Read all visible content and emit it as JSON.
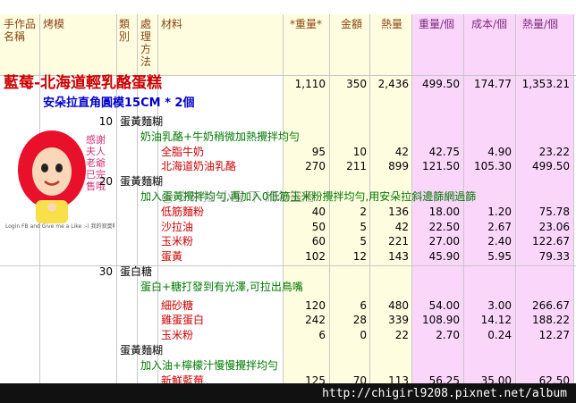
{
  "headers": {
    "name": "手作品名稱",
    "mold": "烤模",
    "category": "類別",
    "method": "處理方法",
    "material": "材料",
    "weight": "*重量*",
    "amount": "金額",
    "heat": "熱量",
    "weight_per": "重量/個",
    "cost_per": "成本/個",
    "heat_per": "熱量/個"
  },
  "recipe": {
    "title": "藍莓-北海道輕乳酪蛋糕",
    "total": {
      "weight": "1,110",
      "amount": "350",
      "heat": "2,436",
      "weight_per": "499.50",
      "cost_per": "174.77",
      "heat_per": "1,353.21"
    },
    "mold": "安朵拉直角圓模15CM * 2個"
  },
  "rows": [
    {
      "kind": "section",
      "cat": "10",
      "text": "蛋黃麵糊"
    },
    {
      "kind": "note",
      "text": "奶油乳酪+牛奶稍微加熱攪拌均勻"
    },
    {
      "kind": "item",
      "text": "全脂牛奶",
      "w": "95",
      "a": "10",
      "h": "42",
      "wp": "42.75",
      "cp": "4.90",
      "hp": "23.22"
    },
    {
      "kind": "item",
      "text": "北海道奶油乳酪",
      "w": "270",
      "a": "211",
      "h": "899",
      "wp": "121.50",
      "cp": "105.30",
      "hp": "499.50"
    },
    {
      "kind": "section",
      "cat": "20",
      "text": "蛋黃麵糊"
    },
    {
      "kind": "note",
      "text": "加入蛋黃攪拌均勻,再加入0低筋玉米粉攪拌均勻,用安朵拉斜邊篩網過篩"
    },
    {
      "kind": "item",
      "text": "低筋麵粉",
      "w": "40",
      "a": "2",
      "h": "136",
      "wp": "18.00",
      "cp": "1.20",
      "hp": "75.78"
    },
    {
      "kind": "item",
      "text": "沙拉油",
      "w": "50",
      "a": "5",
      "h": "42",
      "wp": "22.50",
      "cp": "2.67",
      "hp": "23.06"
    },
    {
      "kind": "item",
      "text": "玉米粉",
      "w": "60",
      "a": "5",
      "h": "221",
      "wp": "27.00",
      "cp": "2.40",
      "hp": "122.67"
    },
    {
      "kind": "item",
      "text": "蛋黃",
      "w": "102",
      "a": "12",
      "h": "143",
      "wp": "45.90",
      "cp": "5.95",
      "hp": "79.33"
    },
    {
      "kind": "section",
      "cat": "30",
      "text": "蛋白糖"
    },
    {
      "kind": "note",
      "text": "蛋白+糖打發到有光澤,可拉出鳥嘴"
    },
    {
      "kind": "item",
      "text": "細砂糖",
      "w": "120",
      "a": "6",
      "h": "480",
      "wp": "54.00",
      "cp": "3.00",
      "hp": "266.67"
    },
    {
      "kind": "item",
      "text": "雞蛋蛋白",
      "w": "242",
      "a": "28",
      "h": "339",
      "wp": "108.90",
      "cp": "14.12",
      "hp": "188.22"
    },
    {
      "kind": "item",
      "text": "玉米粉",
      "w": "6",
      "a": "0",
      "h": "22",
      "wp": "2.70",
      "cp": "0.24",
      "hp": "12.27"
    },
    {
      "kind": "section",
      "cat": "",
      "text": "蛋黃麵糊"
    },
    {
      "kind": "note",
      "text": "加入油+檸檬汁慢慢攪拌均勻"
    },
    {
      "kind": "item",
      "text": "新鮮藍莓",
      "w": "125",
      "a": "70",
      "h": "113",
      "wp": "56.25",
      "cp": "35.00",
      "hp": "62.50"
    }
  ],
  "avatar": {
    "caption": "感謝夫人老爺已完售哦",
    "sub": "Login FB and Give me a Like :-) 我的寂寞啊"
  },
  "watermark": "@ 夕來拉 小屋 下 請勿盜用",
  "footer_url": "http://chigirl9208.pixnet.net/album"
}
